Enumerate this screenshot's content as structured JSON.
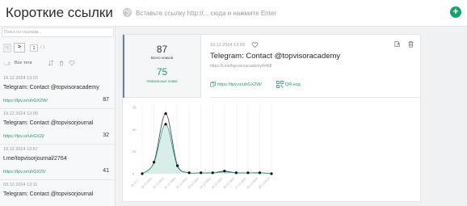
{
  "header": {
    "title": "Короткие ссылки",
    "url_placeholder": "Вставьте ссылку http://... сюда и нажмите Enter",
    "add_label": "+"
  },
  "sidebar": {
    "search_placeholder": "Поиск по ссылкам...",
    "pager": {
      "prev": "<",
      "next": ">",
      "page": "1",
      "total": "/ 1"
    },
    "filter_label": "Все теги",
    "items": [
      {
        "date": "19.12.2024 13:03",
        "title": "Telegram: Contact @topvisoracademy",
        "short": "https://tpv.sr/uhGX2W/",
        "count": "87"
      },
      {
        "date": "19.12.2024 13:00",
        "title": "Telegram: Contact @topvisorjournal",
        "short": "https://tpv.sr/uhGX2j/",
        "count": "32"
      },
      {
        "date": "19.12.2024 12:57",
        "title": "t.me/topvisorjournal/2764",
        "short": "https://tpv.sr/uhGX25/",
        "count": "41"
      },
      {
        "date": "03.12.2024 13:11",
        "title": "Telegram: Contact @topvisorjournal",
        "short": "",
        "count": ""
      }
    ]
  },
  "main": {
    "total_clicks": "87",
    "total_label": "Всего кликов",
    "unique_clicks": "75",
    "unique_label": "Уникальные клики",
    "date": "19.12.2024 13:03",
    "title": "Telegram: Contact @topvisoracademy",
    "url": "https://t.me/topvisoracademy/6468",
    "short_link": "https://tpv.sr/uhGX2W/",
    "qr_label": "QR-код"
  },
  "colors": {
    "accent_green": "#2b9a6a",
    "primary_blue": "#2d74c4",
    "button_green": "#16a36a"
  },
  "chart_data": {
    "type": "area",
    "x": [
      "19.12.2…",
      "19.12.2024",
      "20.12.2024",
      "21.12.2024",
      "22.12.2024",
      "23.12.2024",
      "24.12.2024",
      "25.12.2024",
      "26.12.2024",
      "27.12.2024",
      "28.12.2024",
      "29.12.2024"
    ],
    "ylim": [
      0,
      75
    ],
    "yticks": [
      0,
      25,
      50,
      75
    ],
    "series": [
      {
        "values": [
          0,
          13,
          68,
          9,
          1,
          1,
          1,
          3,
          1,
          1,
          1,
          0
        ],
        "color": "#3a3a4a"
      },
      {
        "values": [
          0,
          12,
          56,
          8,
          1,
          1,
          1,
          2,
          1,
          1,
          1,
          0
        ],
        "color": "#2b9a8a"
      }
    ],
    "grid": true
  }
}
